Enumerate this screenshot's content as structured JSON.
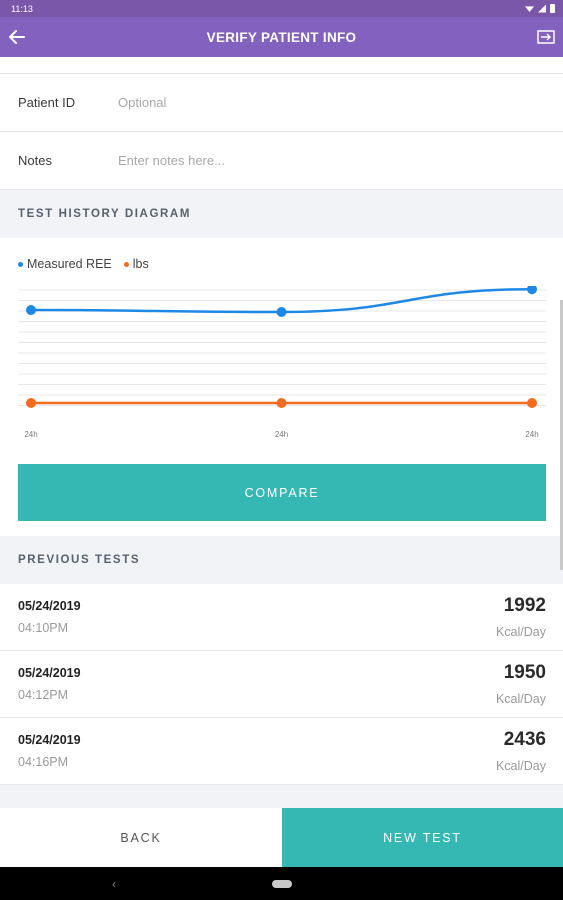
{
  "status_bar": {
    "time": "11:13"
  },
  "app_bar": {
    "title": "VERIFY PATIENT INFO"
  },
  "form": {
    "patient_id": {
      "label": "Patient ID",
      "placeholder": "Optional"
    },
    "notes": {
      "label": "Notes",
      "placeholder": "Enter notes here..."
    }
  },
  "history": {
    "heading": "TEST HISTORY DIAGRAM",
    "compare_label": "COMPARE"
  },
  "chart_data": {
    "type": "line",
    "categories": [
      "24h",
      "24h",
      "24h"
    ],
    "series": [
      {
        "name": "Measured REE",
        "values": [
          1992,
          1950,
          2436
        ],
        "color": "#1e88e5"
      },
      {
        "name": "lbs",
        "values": [
          0,
          0,
          0
        ],
        "color": "#f26b21"
      }
    ],
    "xlabel": "",
    "ylabel": "",
    "grid": true,
    "legend": "top-left"
  },
  "previous": {
    "heading": "PREVIOUS TESTS",
    "tests": [
      {
        "date": "05/24/2019",
        "time": "04:10PM",
        "value": "1992",
        "unit": "Kcal/Day"
      },
      {
        "date": "05/24/2019",
        "time": "04:12PM",
        "value": "1950",
        "unit": "Kcal/Day"
      },
      {
        "date": "05/24/2019",
        "time": "04:16PM",
        "value": "2436",
        "unit": "Kcal/Day"
      }
    ]
  },
  "bottom": {
    "back_label": "BACK",
    "new_test_label": "NEW TEST"
  },
  "nav": {
    "back_glyph": "‹"
  },
  "colors": {
    "accent": "#35b7b4",
    "header": "#8261bf",
    "status": "#7a57a8"
  }
}
